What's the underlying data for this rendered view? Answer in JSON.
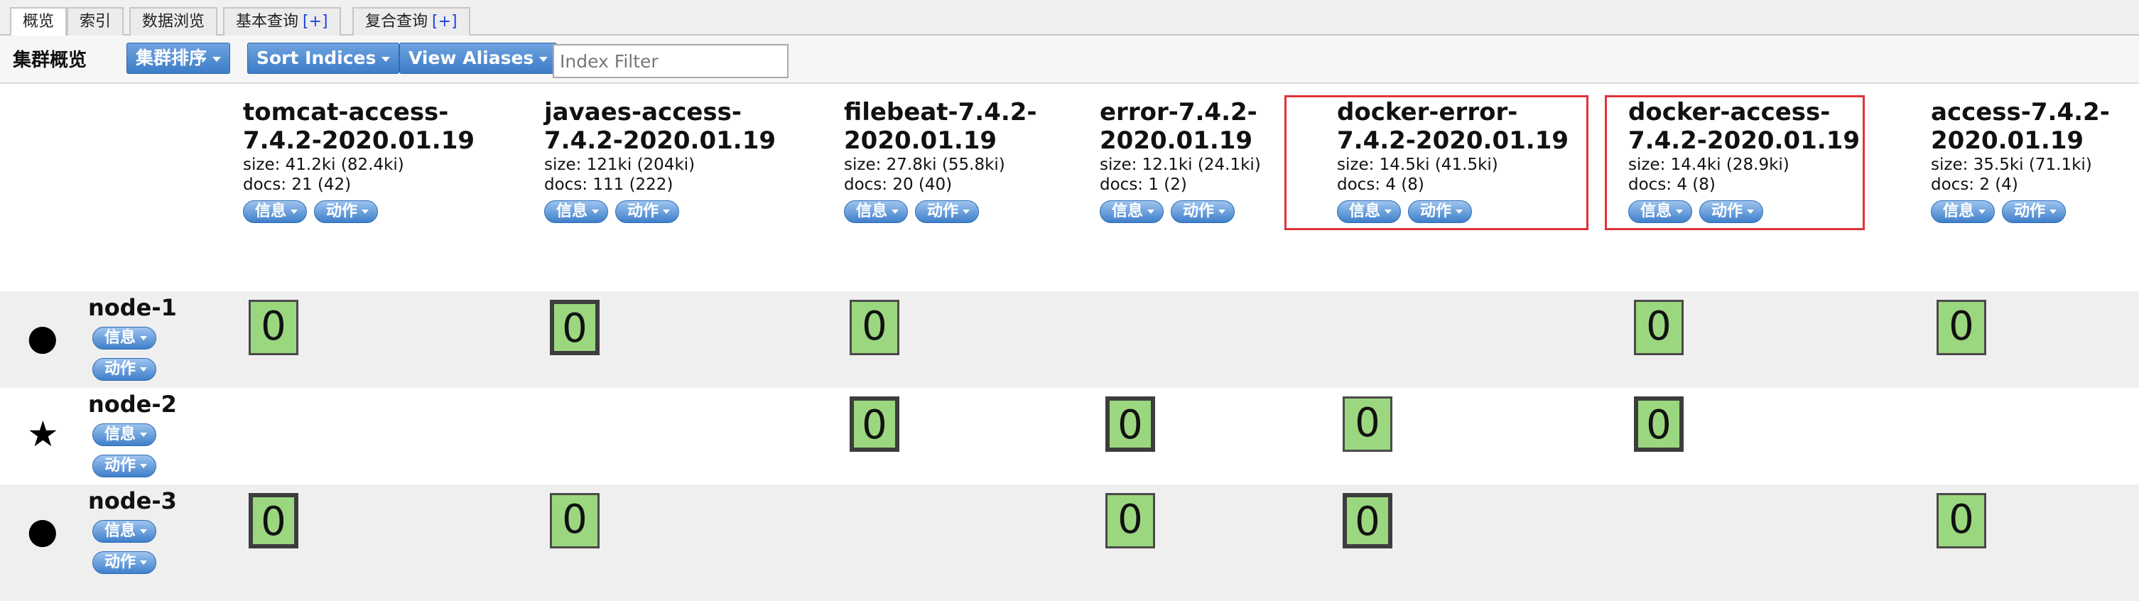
{
  "tabs": [
    {
      "label": "概览",
      "plus": ""
    },
    {
      "label": "索引",
      "plus": ""
    },
    {
      "label": "数据浏览",
      "plus": ""
    },
    {
      "label": "基本查询",
      "plus": "[+]"
    },
    {
      "label": "复合查询",
      "plus": "[+]"
    }
  ],
  "toolbar": {
    "title": "集群概览",
    "sort_cluster": "集群排序",
    "sort_indices": "Sort Indices",
    "view_aliases": "View Aliases",
    "filter_placeholder": "Index Filter"
  },
  "buttons": {
    "info": "信息",
    "action": "动作"
  },
  "indices": [
    {
      "name": "tomcat-access-7.4.2-2020.01.19",
      "line1": "tomcat-access-",
      "line2": "7.4.2-2020.01.19",
      "size": "size: 41.2ki (82.4ki)",
      "docs": "docs: 21 (42)"
    },
    {
      "name": "javaes-access-7.4.2-2020.01.19",
      "line1": "javaes-access-",
      "line2": "7.4.2-2020.01.19",
      "size": "size: 121ki (204ki)",
      "docs": "docs: 111 (222)"
    },
    {
      "name": "filebeat-7.4.2-2020.01.19",
      "line1": "filebeat-7.4.2-",
      "line2": "2020.01.19",
      "size": "size: 27.8ki (55.8ki)",
      "docs": "docs: 20 (40)"
    },
    {
      "name": "error-7.4.2-2020.01.19",
      "line1": "error-7.4.2-",
      "line2": "2020.01.19",
      "size": "size: 12.1ki (24.1ki)",
      "docs": "docs: 1 (2)"
    },
    {
      "name": "docker-error-7.4.2-2020.01.19",
      "line1": "docker-error-",
      "line2": "7.4.2-2020.01.19",
      "size": "size: 14.5ki (41.5ki)",
      "docs": "docs: 4 (8)"
    },
    {
      "name": "docker-access-7.4.2-2020.01.19",
      "line1": "docker-access-",
      "line2": "7.4.2-2020.01.19",
      "size": "size: 14.4ki (28.9ki)",
      "docs": "docs: 4 (8)"
    },
    {
      "name": "access-7.4.2-2020.01.19",
      "line1": "access-7.4.2-",
      "line2": "2020.01.19",
      "size": "size: 35.5ki (71.1ki)",
      "docs": "docs: 2 (4)"
    }
  ],
  "nodes": [
    {
      "name": "node-1",
      "icon": "●",
      "icon_name": "circle-icon",
      "shards": [
        {
          "label": "0",
          "type": "replica"
        },
        {
          "label": "0",
          "type": "primary"
        },
        {
          "label": "0",
          "type": "replica"
        },
        null,
        null,
        {
          "label": "0",
          "type": "replica"
        },
        {
          "label": "0",
          "type": "replica"
        }
      ]
    },
    {
      "name": "node-2",
      "icon": "★",
      "icon_name": "star-icon",
      "shards": [
        null,
        null,
        {
          "label": "0",
          "type": "primary"
        },
        {
          "label": "0",
          "type": "primary"
        },
        {
          "label": "0",
          "type": "replica"
        },
        {
          "label": "0",
          "type": "primary"
        },
        null
      ]
    },
    {
      "name": "node-3",
      "icon": "●",
      "icon_name": "circle-icon",
      "shards": [
        {
          "label": "0",
          "type": "primary"
        },
        {
          "label": "0",
          "type": "replica"
        },
        null,
        {
          "label": "0",
          "type": "replica"
        },
        {
          "label": "0",
          "type": "primary"
        },
        null,
        {
          "label": "0",
          "type": "replica"
        }
      ]
    }
  ],
  "colors": {
    "shard_fill": "#9bd77f",
    "highlight": "#e0333a",
    "button": "#3c7cc8"
  }
}
